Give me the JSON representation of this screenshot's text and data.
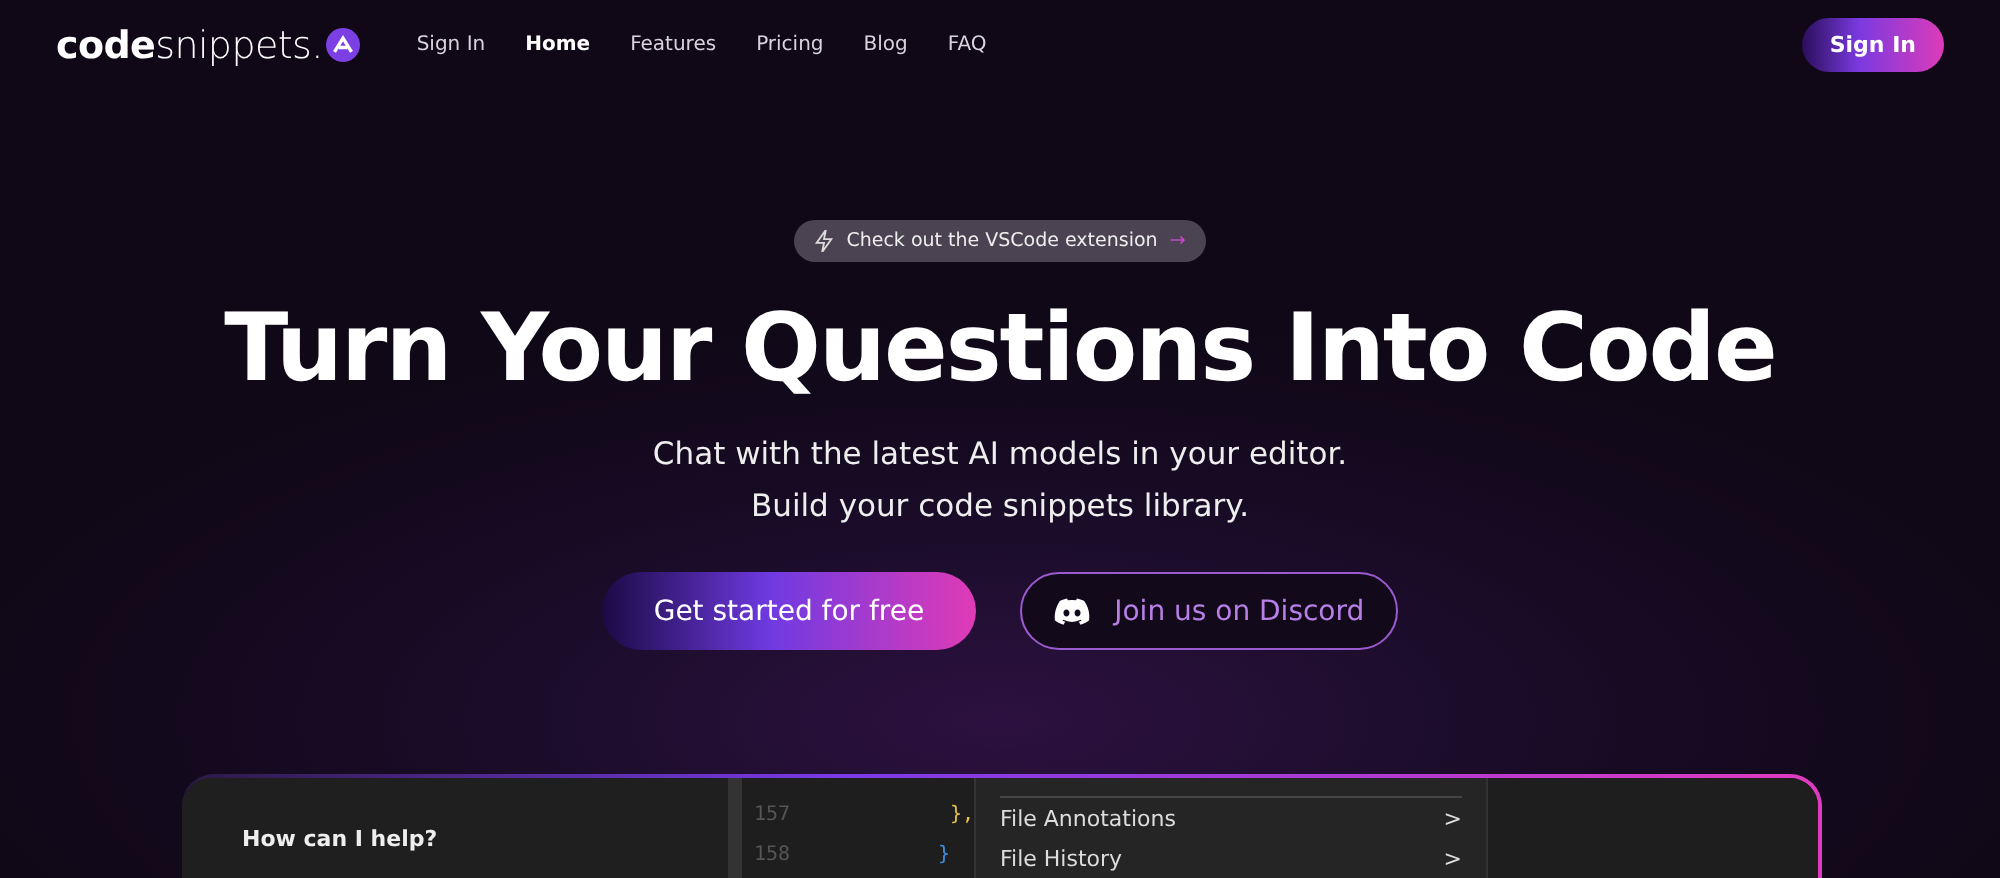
{
  "nav": {
    "logo": {
      "text_bold": "code",
      "text_light": "snippets."
    },
    "links": [
      {
        "label": "Sign In",
        "selected": false
      },
      {
        "label": "Home",
        "selected": true
      },
      {
        "label": "Features",
        "selected": false
      },
      {
        "label": "Pricing",
        "selected": false
      },
      {
        "label": "Blog",
        "selected": false
      },
      {
        "label": "FAQ",
        "selected": false
      }
    ],
    "cta": "Sign In"
  },
  "hero": {
    "badge": {
      "text": "Check out the VSCode extension",
      "arrow": "→"
    },
    "title": "Turn Your Questions Into Code",
    "subtitle_lines": [
      "Chat with the latest AI models in your editor.",
      "Build your code snippets library."
    ],
    "buttons": [
      {
        "kind": "primary",
        "label": "Get started for free"
      },
      {
        "kind": "discord",
        "label": "Join us on Discord"
      }
    ]
  },
  "demo": {
    "chat_prompt": "How can I help?",
    "code_lines": [
      {
        "number": "157",
        "code": "},"
      },
      {
        "number": "158",
        "code": "}"
      }
    ],
    "menu_items": [
      {
        "label": "File Annotations",
        "arrow": ">"
      },
      {
        "label": "File History",
        "arrow": ">"
      }
    ]
  }
}
